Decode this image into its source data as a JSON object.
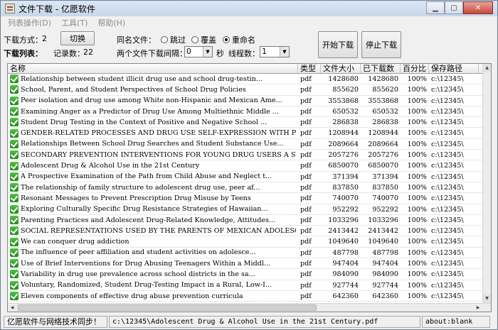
{
  "window": {
    "title": "文件下载 - 亿愿软件"
  },
  "menu": [
    "列表操作(D)",
    "工具(T)",
    "帮助(H)"
  ],
  "toolbar": {
    "download_mode_label": "下载方式：",
    "download_mode_value": "2",
    "switch_button": "切换",
    "list_label": "下载列表：",
    "record_count_label": "记录数：",
    "record_count_value": "22",
    "same_name_label": "同名文件：",
    "opt_skip": "跳过",
    "opt_overwrite": "覆盖",
    "opt_rename": "重命名",
    "selected_option": "rename",
    "interval_label": "两个文件下载间隔：",
    "interval_value": "0",
    "seconds_label": "秒",
    "threads_label": "线程数：",
    "threads_value": "1",
    "start_button": "开始下载",
    "stop_button": "停止下载"
  },
  "table": {
    "columns": [
      "名称",
      "类型",
      "文件大小",
      "已下载数",
      "百分比",
      "保存路径"
    ],
    "rows": [
      [
        "Relationship between student illicit drug use and school drug-testin...",
        "pdf",
        "1428680",
        "1428680",
        "100%",
        "c:\\12345\\"
      ],
      [
        "School, Parent, and Student Perspectives of School Drug Policies",
        "pdf",
        "855620",
        "855620",
        "100%",
        "c:\\12345\\"
      ],
      [
        "Peer isolation and drug use among White non-Hispanic and Mexican Ame...",
        "pdf",
        "3553868",
        "3553868",
        "100%",
        "c:\\12345\\"
      ],
      [
        "Examining Anger as a Predictor of Drug Use Among Multiethnic Middle ...",
        "pdf",
        "650532",
        "650532",
        "100%",
        "c:\\12345\\"
      ],
      [
        "Student Drug Testing in the Context of Positive and Negative School ...",
        "pdf",
        "286838",
        "286838",
        "100%",
        "c:\\12345\\"
      ],
      [
        "GENDER-RELATED PROCESSES AND DRUG USE SELF-EXPRESSION WITH PARENTS, ...",
        "pdf",
        "1208944",
        "1208944",
        "100%",
        "c:\\12345\\"
      ],
      [
        "Relationships Between School Drug Searches and Student Substance Use...",
        "pdf",
        "2089664",
        "2089664",
        "100%",
        "c:\\12345\\"
      ],
      [
        "SECONDARY PREVENTION INTERVENTIONS FOR YOUNG DRUG USERS A SYSTEMATIC...",
        "pdf",
        "2057276",
        "2057276",
        "100%",
        "c:\\12345\\"
      ],
      [
        "Adolescent Drug & Alcohol Use in the 21st Century",
        "pdf",
        "6850070",
        "6850070",
        "100%",
        "c:\\12345\\"
      ],
      [
        "A Prospective Examination of the Path from Child Abuse and Neglect t...",
        "pdf",
        "371394",
        "371394",
        "100%",
        "c:\\12345\\"
      ],
      [
        "The relationship of family structure to adolescent drug use, peer af...",
        "pdf",
        "837850",
        "837850",
        "100%",
        "c:\\12345\\"
      ],
      [
        "Resonant Messages to Prevent Prescription Drug Misuse by Teens",
        "pdf",
        "740070",
        "740070",
        "100%",
        "c:\\12345\\"
      ],
      [
        "Exploring Culturally Specific Drug Resistance Strategies of Hawaiian...",
        "pdf",
        "952292",
        "952292",
        "100%",
        "c:\\12345\\"
      ],
      [
        "Parenting Practices and Adolescent Drug-Related Knowledge, Attitudes...",
        "pdf",
        "1033296",
        "1033296",
        "100%",
        "c:\\12345\\"
      ],
      [
        "SOCIAL REPRESENTATIONS USED BY THE PARENTS OF MEXICAN ADOLESCENT DRU...",
        "pdf",
        "2413442",
        "2413442",
        "100%",
        "c:\\12345\\"
      ],
      [
        "We can conquer drug addiction",
        "pdf",
        "1049640",
        "1049640",
        "100%",
        "c:\\12345\\"
      ],
      [
        "The influence of peer affiliation and student activities on adolesce...",
        "pdf",
        "487798",
        "487798",
        "100%",
        "c:\\12345\\"
      ],
      [
        "Use of Brief Interventions for Drug Abusing Teenagers Within a Middl...",
        "pdf",
        "947404",
        "947404",
        "100%",
        "c:\\12345\\"
      ],
      [
        "Variability in drug use prevalence across school districts in the sa...",
        "pdf",
        "984090",
        "984090",
        "100%",
        "c:\\12345\\"
      ],
      [
        "Voluntary, Randomized, Student Drug-Testing Impact in a Rural, Low-I...",
        "pdf",
        "927744",
        "927744",
        "100%",
        "c:\\12345\\"
      ],
      [
        "Eleven components of effective drug abuse prevention curricula",
        "pdf",
        "642360",
        "642360",
        "100%",
        "c:\\12345\\"
      ]
    ]
  },
  "status": {
    "left": "亿愿软件与网络技术同步！",
    "middle": "c:\\12345\\Adolescent Drug & Alcohol Use in the 21st Century.pdf",
    "right": "about:blank"
  }
}
